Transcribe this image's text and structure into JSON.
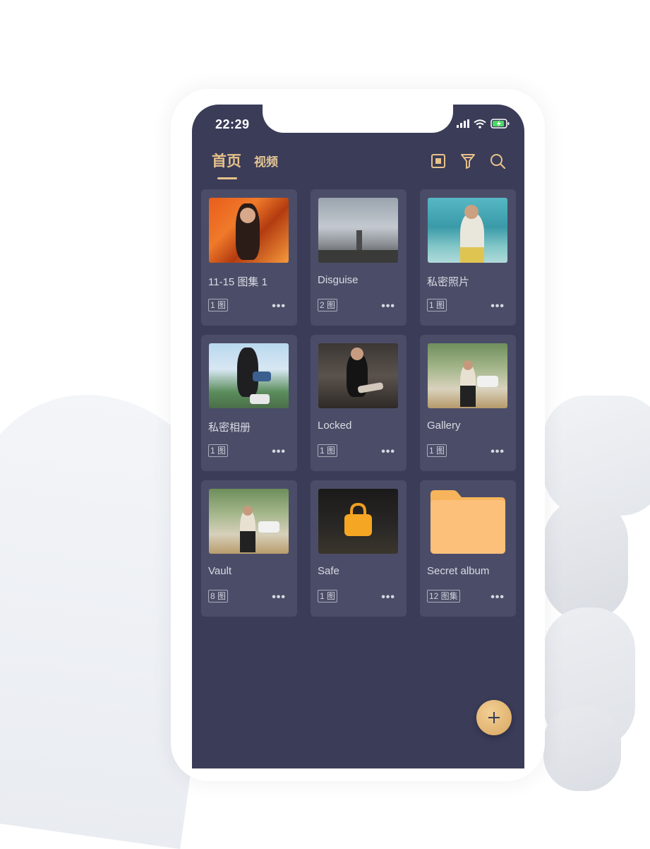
{
  "status_bar": {
    "time": "22:29"
  },
  "header": {
    "tabs": [
      {
        "label": "首页",
        "active": true
      },
      {
        "label": "视频",
        "active": false
      }
    ],
    "actions": [
      "square-icon",
      "filter-icon",
      "search-icon"
    ]
  },
  "albums": [
    {
      "title": "11-15 图集 1",
      "count": "1 图"
    },
    {
      "title": "Disguise",
      "count": "2 图"
    },
    {
      "title": "私密照片",
      "count": "1 图"
    },
    {
      "title": "私密相册",
      "count": "1 图"
    },
    {
      "title": "Locked",
      "count": "1 图"
    },
    {
      "title": "Gallery",
      "count": "1 图"
    },
    {
      "title": "Vault",
      "count": "8 图"
    },
    {
      "title": "Safe",
      "count": "1 图"
    },
    {
      "title": "Secret album",
      "count": "12 图集"
    }
  ],
  "more_label": "•••",
  "fab_label": "+",
  "colors": {
    "background": "#3a3c58",
    "card": "#4b4d68",
    "accent": "#e8c28a"
  }
}
